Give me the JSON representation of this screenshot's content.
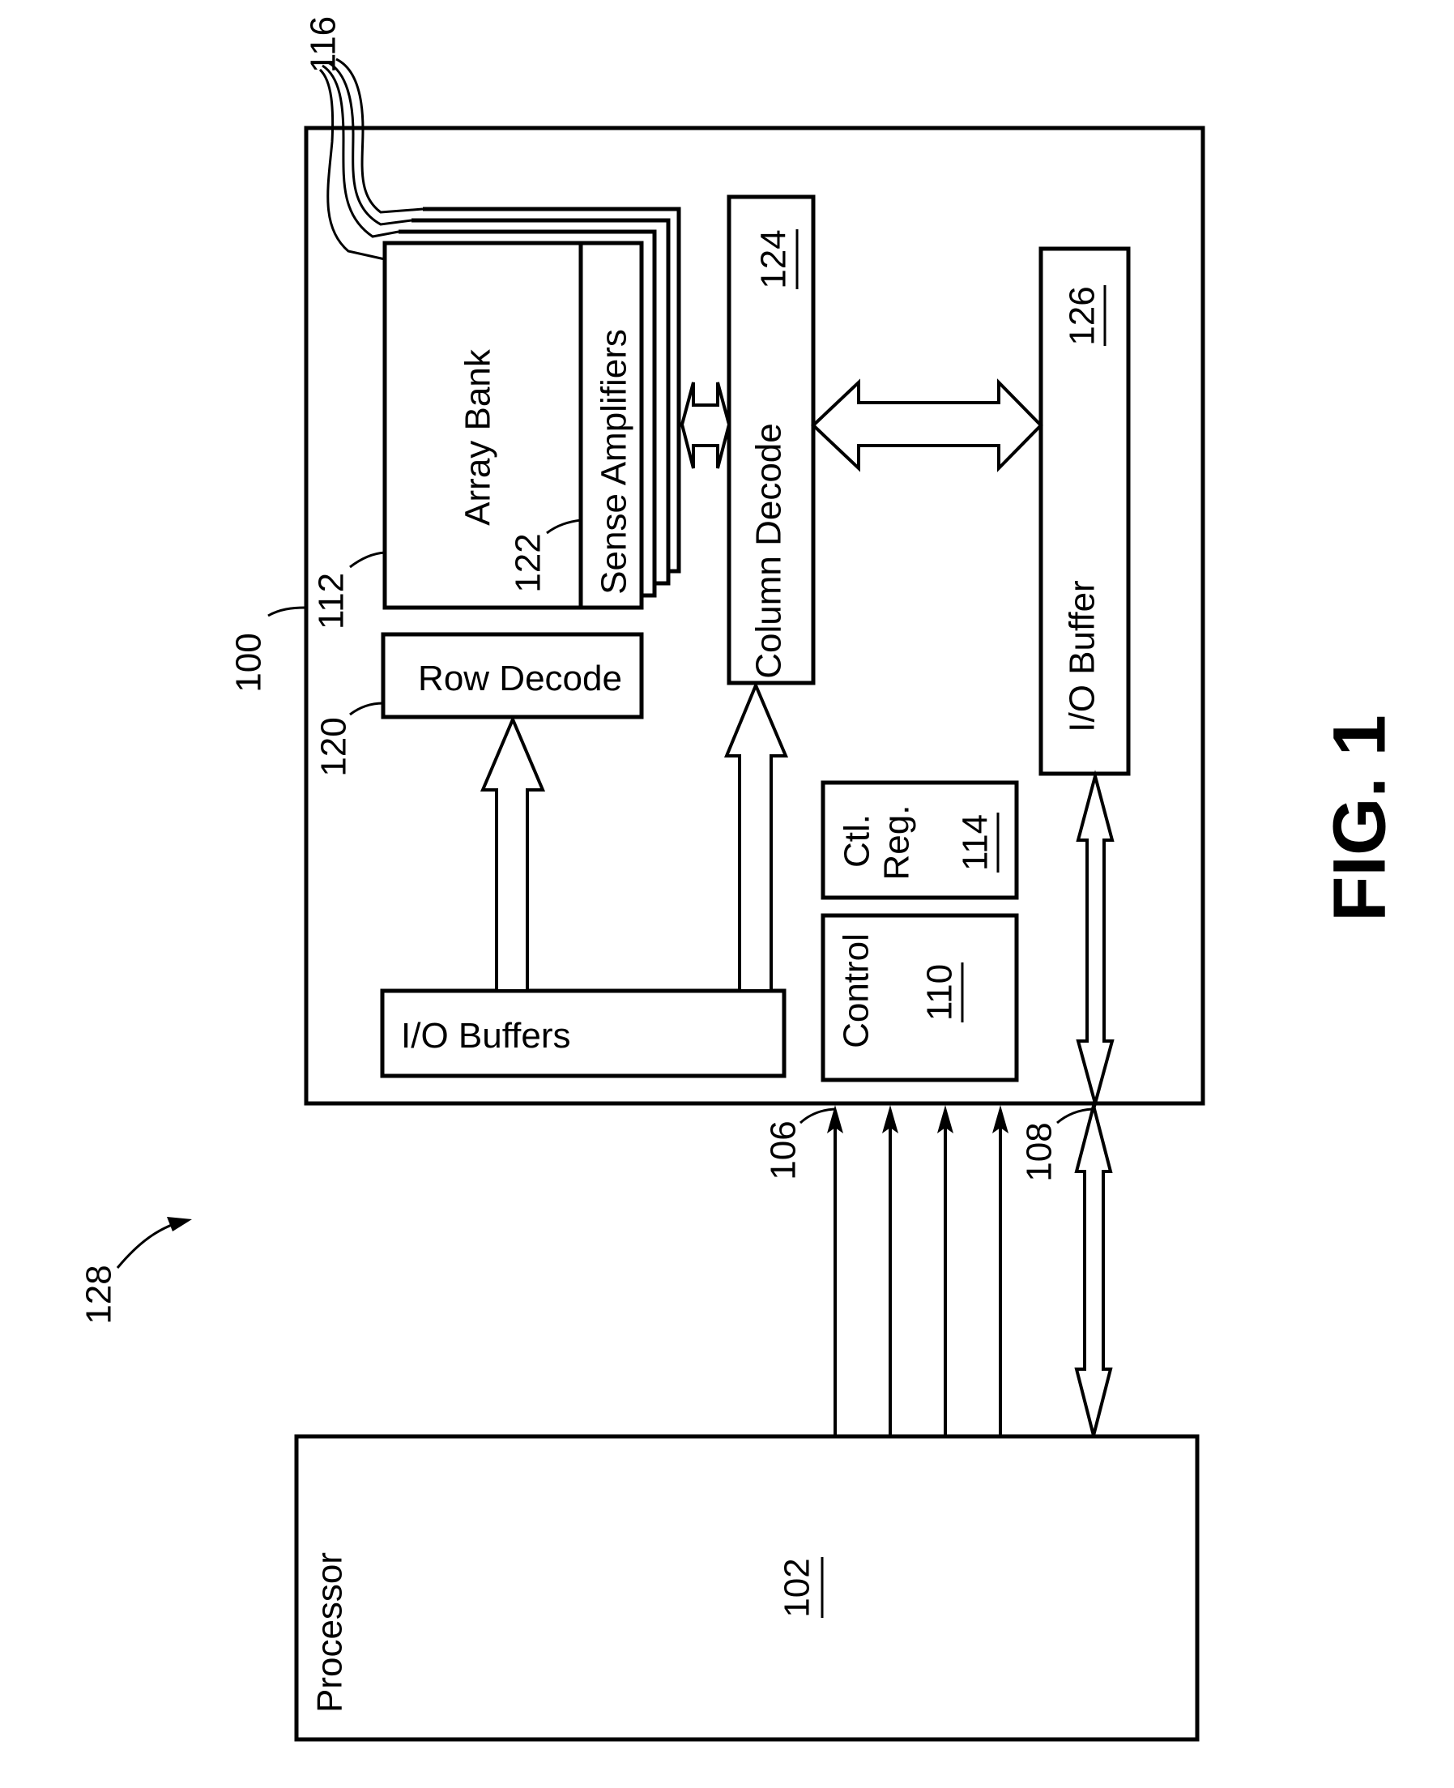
{
  "figure": {
    "title": "FIG. 1",
    "system_ref": "128",
    "memory_device": {
      "ref": "100"
    },
    "array_stack": {
      "ref": "116",
      "layers": 4
    },
    "blocks": {
      "array_bank": {
        "label": "Array Bank",
        "ref": "112"
      },
      "sense_amplifiers": {
        "label": "Sense Amplifiers",
        "ref": "122"
      },
      "row_decode": {
        "label": "Row Decode",
        "ref": "120"
      },
      "column_decode": {
        "label": "Column Decode",
        "ref": "124"
      },
      "io_buffer": {
        "label": "I/O Buffer",
        "ref": "126"
      },
      "io_buffers": {
        "label": "I/O Buffers"
      },
      "ctl_reg": {
        "label_line1": "Ctl.",
        "label_line2": "Reg.",
        "ref": "114"
      },
      "control": {
        "label": "Control",
        "ref": "110"
      },
      "processor": {
        "label": "Processor",
        "ref": "102"
      }
    },
    "connections": {
      "control_lines": {
        "ref": "106",
        "count": 4
      },
      "data_bus": {
        "ref": "108"
      }
    }
  }
}
